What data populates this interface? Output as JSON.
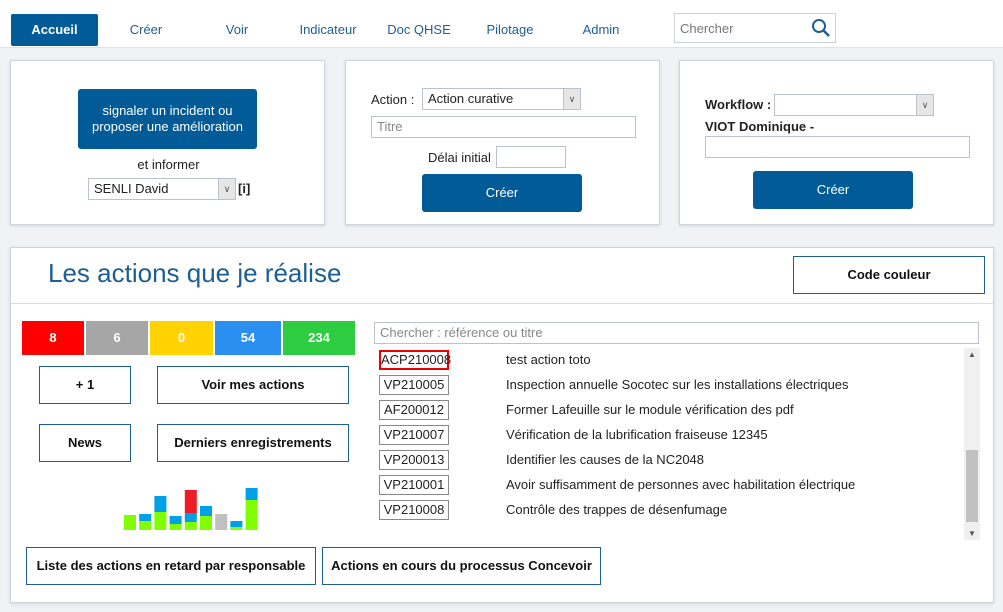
{
  "nav": {
    "tabs": [
      {
        "label": "Accueil",
        "active": true
      },
      {
        "label": "Créer"
      },
      {
        "label": "Voir"
      },
      {
        "label": "Indicateur"
      },
      {
        "label": "Doc QHSE"
      },
      {
        "label": "Pilotage"
      },
      {
        "label": "Admin"
      }
    ],
    "search_placeholder": "Chercher",
    "search_icon": "magnifier-icon"
  },
  "incident": {
    "button": "signaler un incident ou proposer une amélioration",
    "inform_label": "et informer",
    "person": "SENLI David",
    "info": "[i]"
  },
  "action": {
    "label": "Action :",
    "type": "Action curative",
    "title_placeholder": "Titre",
    "delay_label": "Délai initial",
    "delay_value": "",
    "create": "Créer"
  },
  "workflow": {
    "label": "Workflow :",
    "value": "",
    "person": "VIOT Dominique -",
    "field": "",
    "create": "Créer"
  },
  "main": {
    "title": "Les actions que je réalise",
    "color_code": "Code couleur",
    "counters": [
      {
        "value": "8",
        "color": "#ff0000"
      },
      {
        "value": "6",
        "color": "#a6a6a6"
      },
      {
        "value": "0",
        "color": "#ffd200"
      },
      {
        "value": "54",
        "color": "#2b8ff0"
      },
      {
        "value": "234",
        "color": "#2ecc40"
      }
    ],
    "plus_one": "+ 1",
    "my_actions": "Voir mes actions",
    "news": "News",
    "last_records": "Derniers enregistrements",
    "late_by_owner": "Liste des actions en retard par responsable",
    "process_actions": "Actions en cours du processus Concevoir",
    "list_search_placeholder": "Chercher : référence ou titre",
    "actions": [
      {
        "ref": "ACP210008",
        "title": "test action toto",
        "highlight": true
      },
      {
        "ref": "VP210005",
        "title": "Inspection annuelle Socotec sur les installations électriques"
      },
      {
        "ref": "AF200012",
        "title": "Former Lafeuille sur le module vérification des pdf"
      },
      {
        "ref": "VP210007",
        "title": "Vérification de la lubrification fraiseuse 12345"
      },
      {
        "ref": "VP200013",
        "title": "Identifier les causes de la NC2048"
      },
      {
        "ref": "VP210001",
        "title": "Avoir suffisamment de personnes avec habilitation électrique"
      },
      {
        "ref": "VP210008",
        "title": "Contrôle des trappes de désenfumage"
      }
    ]
  },
  "chart_data": {
    "type": "bar",
    "stacked": true,
    "colors": {
      "green": "#7fff00",
      "blue": "#00a0e8",
      "red": "#ee1c25",
      "grey": "#c0c0c0"
    },
    "series": [
      {
        "color": "green",
        "values": [
          15,
          9,
          18,
          6,
          8,
          14,
          0,
          3,
          30
        ]
      },
      {
        "color": "blue",
        "values": [
          0,
          7,
          16,
          8,
          9,
          10,
          0,
          6,
          12
        ]
      },
      {
        "color": "red",
        "values": [
          0,
          0,
          0,
          0,
          23,
          0,
          0,
          0,
          0
        ]
      },
      {
        "color": "grey",
        "values": [
          0,
          0,
          0,
          0,
          0,
          0,
          16,
          0,
          0
        ]
      }
    ]
  }
}
